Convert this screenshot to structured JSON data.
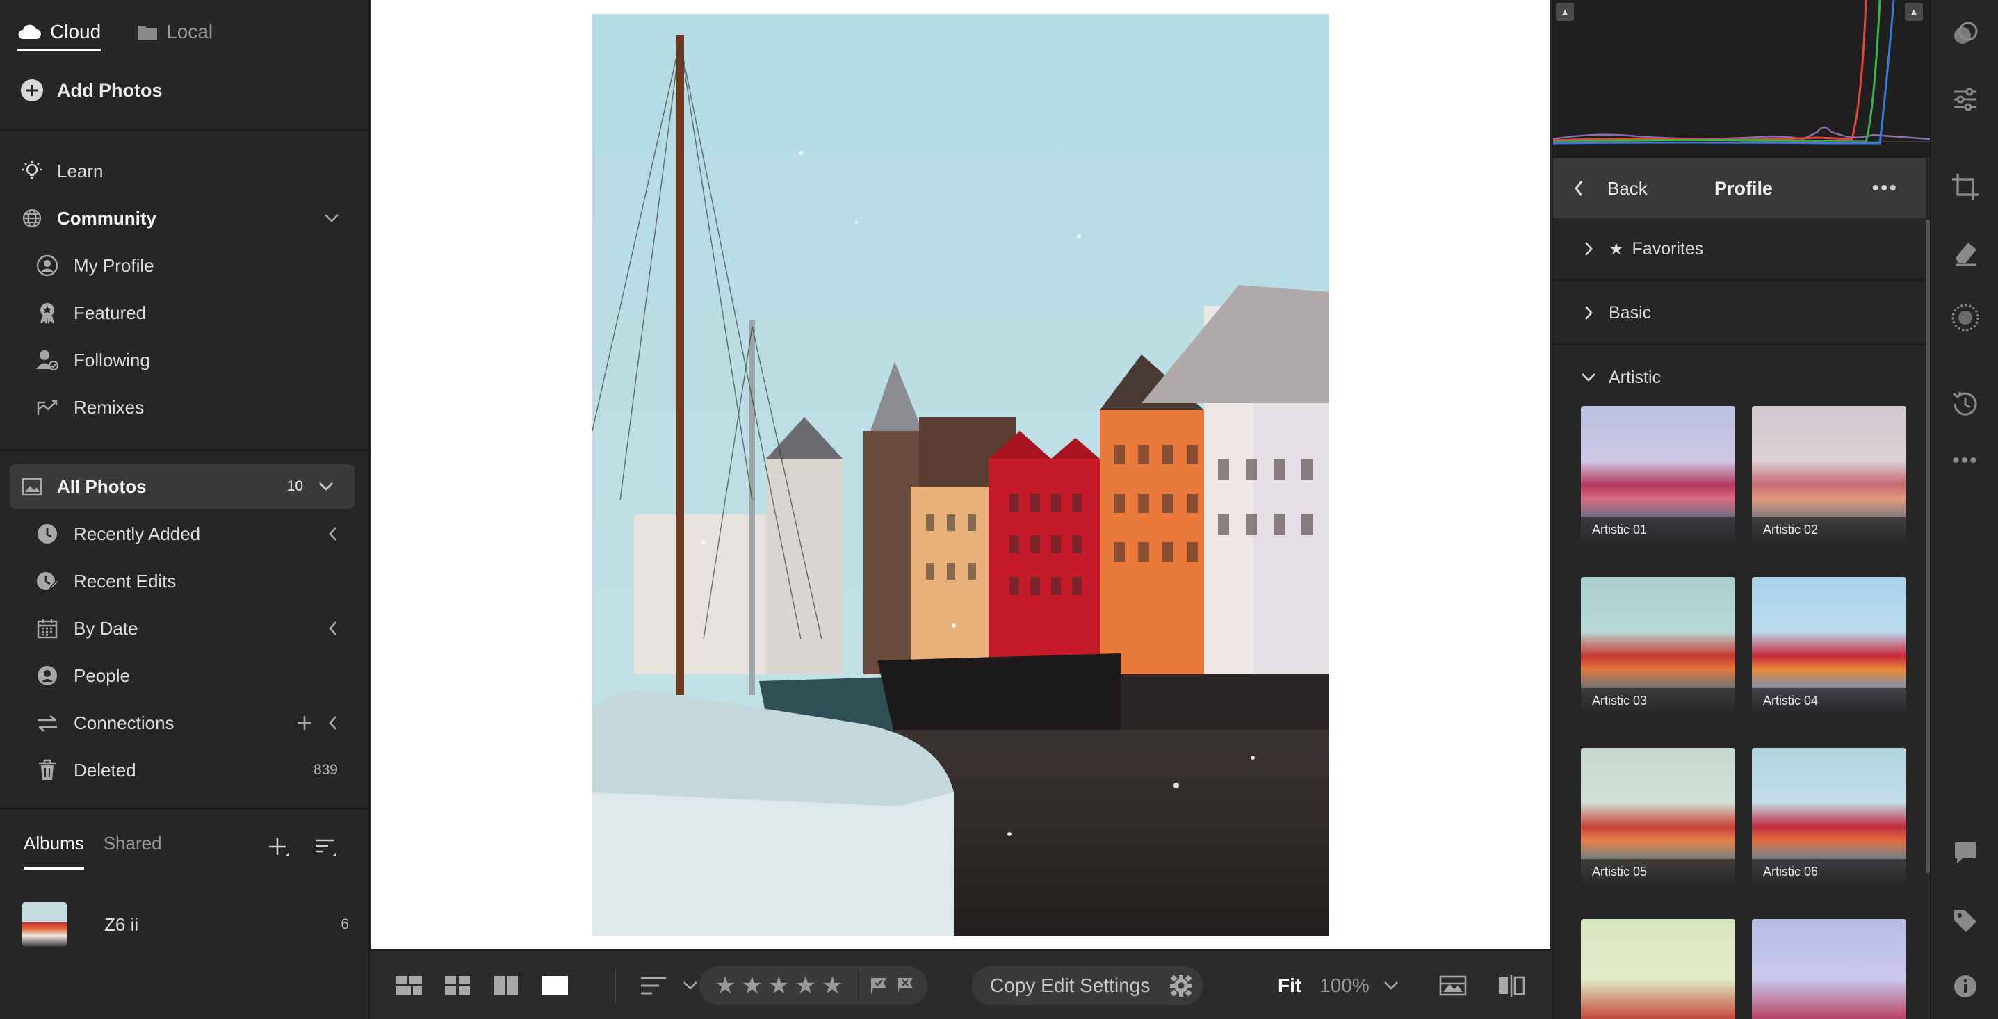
{
  "left": {
    "tabs": [
      {
        "label": "Cloud",
        "icon": "cloud-icon",
        "active": true
      },
      {
        "label": "Local",
        "icon": "folder-icon",
        "active": false
      }
    ],
    "add_photos": "Add Photos",
    "learn": "Learn",
    "community": {
      "label": "Community",
      "items": [
        "My Profile",
        "Featured",
        "Following",
        "Remixes"
      ]
    },
    "all_photos": {
      "label": "All Photos",
      "count": "10"
    },
    "library_items": [
      {
        "label": "Recently Added"
      },
      {
        "label": "Recent Edits"
      },
      {
        "label": "By Date"
      },
      {
        "label": "People"
      },
      {
        "label": "Connections"
      },
      {
        "label": "Deleted",
        "count": "839"
      }
    ],
    "albums": {
      "tabs": [
        "Albums",
        "Shared"
      ],
      "items": [
        {
          "name": "Z6 ii",
          "count": "6"
        }
      ]
    }
  },
  "bottom_bar": {
    "copy_edit_settings": "Copy Edit Settings",
    "zoom_fit": "Fit",
    "zoom_value": "100%",
    "rating_stars": 5,
    "rating_value": 0
  },
  "right": {
    "back": "Back",
    "title": "Profile",
    "groups": [
      {
        "label": "Favorites",
        "expanded": false
      },
      {
        "label": "Basic",
        "expanded": false
      },
      {
        "label": "Artistic",
        "expanded": true
      }
    ],
    "presets": [
      "Artistic 01",
      "Artistic 02",
      "Artistic 03",
      "Artistic 04",
      "Artistic 05",
      "Artistic 06",
      "",
      ""
    ]
  },
  "colors": {
    "panel_bg": "#262626",
    "accent_white": "#ffffff",
    "hist_red": "#e0463a",
    "hist_green": "#3fb24a",
    "hist_blue": "#3b78e0"
  }
}
